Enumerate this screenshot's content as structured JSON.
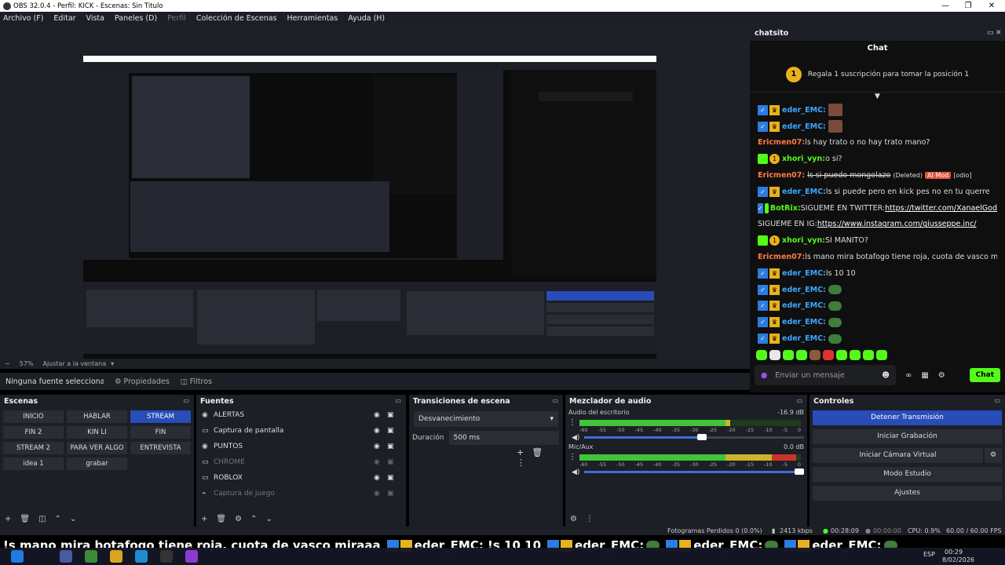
{
  "window": {
    "title": "OBS 32.0.4 - Perfil: KICK - Escenas: Sin Titulo",
    "minimize": "—",
    "maximize": "❐",
    "close": "✕"
  },
  "menu": [
    "Archivo (F)",
    "Editar",
    "Vista",
    "Paneles (D)",
    "Perfil",
    "Colección de Escenas",
    "Herramientas",
    "Ayuda (H)"
  ],
  "zoombar": {
    "minus": "−",
    "zoom": "57%",
    "fit": "Ajustar a la ventana",
    "arrow": "▾"
  },
  "source_bar": {
    "none": "Ninguna fuente seleccionada",
    "properties": "Propiedades",
    "filters": "Filtros"
  },
  "chat_dock": {
    "title": "chatsito",
    "header": "Chat",
    "pin_coin": "1",
    "pin": "Regala 1 suscripción para tomar la posición 1",
    "messages": [
      {
        "user": "eder_EMC",
        "sep": ":",
        "text": "",
        "emote": "face",
        "style": "u1"
      },
      {
        "user": "eder_EMC",
        "sep": ":",
        "text": "",
        "emote": "face",
        "style": "u1"
      },
      {
        "user": "Ericmen07",
        "sep": ":",
        "text": " ls hay trato o no hay trato mano?",
        "emote": "",
        "style": "u3"
      },
      {
        "user": "xhori_vyn",
        "sep": ":",
        "text": " o si?",
        "emote": "",
        "style": "u2"
      },
      {
        "user": "Ericmen07",
        "sep": ":",
        "text": "",
        "emote": "",
        "style": "u3",
        "strike": "ls si puedo mongolazo",
        "deleted": "(Deleted)",
        "tag": "AI Mod",
        "after": "[odio]"
      },
      {
        "user": "eder_EMC",
        "sep": ":",
        "text": " ls si puede pero en kick pes no en tu querre",
        "emote": "",
        "style": "u1"
      },
      {
        "user": "BotRix",
        "sep": ":",
        "text": " SIGUEME EN TWITTER: ",
        "link": "https://twitter.com/XanaelGod",
        "emote": "",
        "style": "u2"
      },
      {
        "user": "",
        "sep": "",
        "text": "SIGUEME EN IG: ",
        "link": "https://www.instagram.com/giusseppe.inc/",
        "emote": "",
        "style": "u2"
      },
      {
        "user": "xhori_vyn",
        "sep": ":",
        "text": " SI MANITO?",
        "emote": "",
        "style": "u2"
      },
      {
        "user": "Ericmen07",
        "sep": ":",
        "text": " ls mano mira botafogo tiene roja, cuota de vasco miraaa",
        "emote": "",
        "style": "u3"
      },
      {
        "user": "eder_EMC",
        "sep": ":",
        "text": " ls 10 10",
        "emote": "",
        "style": "u1"
      },
      {
        "user": "eder_EMC",
        "sep": ":",
        "text": "",
        "emote": "frog",
        "style": "u1"
      },
      {
        "user": "eder_EMC",
        "sep": ":",
        "text": "",
        "emote": "frog",
        "style": "u1"
      },
      {
        "user": "eder_EMC",
        "sep": ":",
        "text": "",
        "emote": "frog",
        "style": "u1"
      },
      {
        "user": "eder_EMC",
        "sep": ":",
        "text": "",
        "emote": "frog",
        "style": "u1"
      }
    ],
    "input_placeholder": "Enviar un mensaje",
    "chat_button": "Chat"
  },
  "scenes": {
    "title": "Escenas",
    "items": [
      "INICIO",
      "HABLAR",
      "STREAM",
      "FIN 2",
      "KIN LI",
      "FIN",
      "STREAM 2",
      "PARA VER ALGO",
      "ENTREVISTA",
      "idea 1",
      "grabar"
    ],
    "active": "STREAM"
  },
  "sources": {
    "title": "Fuentes",
    "items": [
      {
        "name": "ALERTAS",
        "icon": "browser-icon",
        "glyph": "◉",
        "visible": true
      },
      {
        "name": "Captura de pantalla",
        "icon": "monitor-icon",
        "glyph": "▭",
        "visible": true
      },
      {
        "name": "PUNTOS",
        "icon": "browser-icon",
        "glyph": "◉",
        "visible": true
      },
      {
        "name": "CHROME",
        "icon": "window-icon",
        "glyph": "▭",
        "visible": false
      },
      {
        "name": "ROBLOX",
        "icon": "window-icon",
        "glyph": "▭",
        "visible": true
      },
      {
        "name": "Captura de juego",
        "icon": "gamepad-icon",
        "glyph": "⌁",
        "visible": false
      }
    ]
  },
  "transitions": {
    "title": "Transiciones de escena",
    "selected": "Desvanecimiento",
    "duration_label": "Duración",
    "duration": "500 ms"
  },
  "mixer": {
    "title": "Mezclador de audio",
    "channels": [
      {
        "name": "Audio del escritorio",
        "db": "-16.9 dB",
        "level": 0.68,
        "volume": 0.52
      },
      {
        "name": "Mic/Aux",
        "db": "0.0 dB",
        "level": 0.98,
        "volume": 0.97
      }
    ],
    "ticks": [
      "-60",
      "-55",
      "-50",
      "-45",
      "-40",
      "-35",
      "-30",
      "-25",
      "-20",
      "-15",
      "-10",
      "-5",
      "0"
    ]
  },
  "controls": {
    "title": "Controles",
    "buttons": [
      "Detener Transmisión",
      "Iniciar Grabación",
      "Iniciar Cámara Virtual",
      "Modo Estudio",
      "Ajustes"
    ]
  },
  "status": {
    "dropped": "Fotogramas Perdidos 0 (0.0%)",
    "bitrate": "2413 kbps",
    "live": "00:28:09",
    "rec": "00:00:00",
    "cpu": "CPU: 0.9%",
    "fps": "60.00 / 60.00 FPS"
  },
  "ticker": {
    "lead": "!s mano mira botafogo tiene roja, cuota de vasco miraaa",
    "user": "eder_EMC",
    "text1": " : !s 10 10",
    "sep": " : "
  },
  "taskbar": {
    "lang": "ESP",
    "time": "00:29",
    "date": "8/02/2026"
  },
  "colors": {
    "accent": "#284cb8",
    "kick_green": "#53fc18",
    "bg": "#1d1f26"
  }
}
